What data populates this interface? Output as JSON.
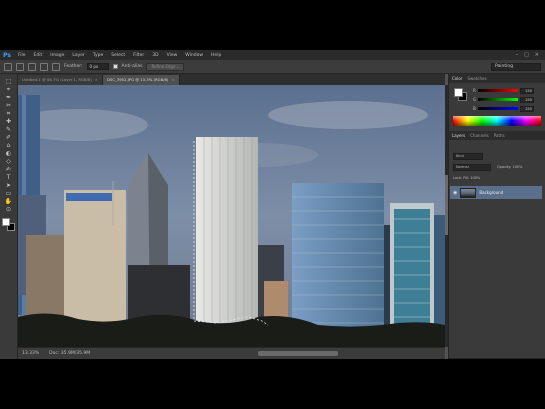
{
  "app": {
    "logo": "Ps"
  },
  "menu": [
    "File",
    "Edit",
    "Image",
    "Layer",
    "Type",
    "Select",
    "Filter",
    "3D",
    "View",
    "Window",
    "Help"
  ],
  "window_controls": [
    "–",
    "□",
    "×"
  ],
  "options": {
    "feather_label": "Feather:",
    "feather_value": "0 px",
    "antialias_label": "Anti-alias",
    "refine_edge": "Refine Edge...",
    "workspace": "Painting"
  },
  "tabs": [
    {
      "label": "Untitled-1 @ 66.7% (Layer 1, RGB/8)",
      "active": false
    },
    {
      "label": "DSC_3952.JPG @ 13.3% (RGB/8)",
      "active": true
    }
  ],
  "tools": [
    "⬚",
    "⌖",
    "✒",
    "✂",
    "⌗",
    "✚",
    "✎",
    "✐",
    "⌂",
    "◐",
    "◇",
    "✍",
    "T",
    "➤",
    "▭",
    "✋",
    "⊙"
  ],
  "status": {
    "zoom": "13.33%",
    "doc": "Doc: 35.9M/35.9M"
  },
  "panels": {
    "color_tabs": [
      "Color",
      "Swatches"
    ],
    "sliders": [
      {
        "label": "R",
        "value": "255",
        "colors": [
          "#000000",
          "#ff0000"
        ]
      },
      {
        "label": "G",
        "value": "255",
        "colors": [
          "#000000",
          "#00ff00"
        ]
      },
      {
        "label": "B",
        "value": "255",
        "colors": [
          "#000000",
          "#0000ff"
        ]
      }
    ],
    "layer_tabs": [
      "Layers",
      "Channels",
      "Paths"
    ],
    "kind": "Kind",
    "blend": "Normal",
    "opacity": "Opacity: 100%",
    "lock": "Lock:        Fill: 100%",
    "layer_name": "Background",
    "eye": "👁"
  },
  "colors": {
    "accent": "#31a8ff",
    "panel": "#3a3a3a",
    "layer_selected": "#5a6f8c"
  }
}
